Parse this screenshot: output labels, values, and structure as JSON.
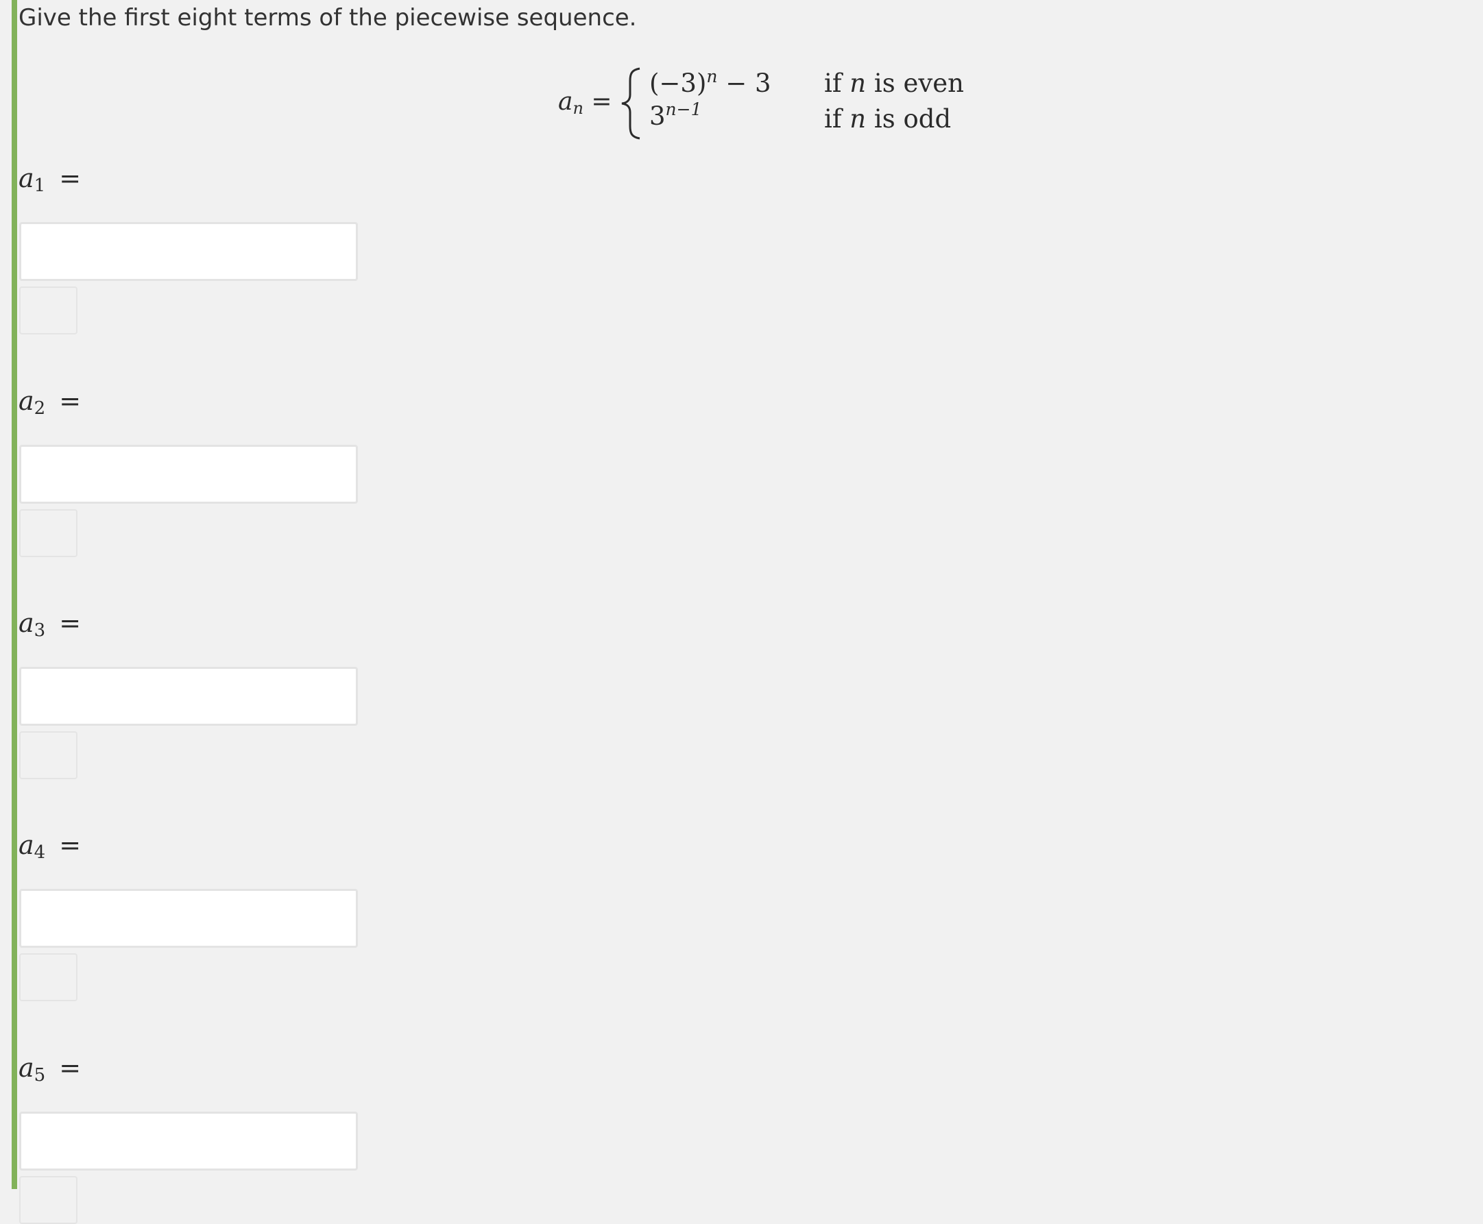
{
  "question": {
    "prompt": "Give the first eight terms of the piecewise sequence."
  },
  "formula": {
    "lhs_var": "a",
    "lhs_sub": "n",
    "equals": "=",
    "case_even_expr": "(−3)",
    "case_even_exp": "n",
    "case_even_tail": " − 3",
    "case_odd_base": "3",
    "case_odd_exp": "n−1",
    "cond_even": {
      "if": "if ",
      "var": "n",
      "rest": " is even"
    },
    "cond_odd": {
      "if": "if ",
      "var": "n",
      "rest": " is odd"
    }
  },
  "terms": [
    {
      "var": "a",
      "sub": "1",
      "equals": "=",
      "value": ""
    },
    {
      "var": "a",
      "sub": "2",
      "equals": "=",
      "value": ""
    },
    {
      "var": "a",
      "sub": "3",
      "equals": "=",
      "value": ""
    },
    {
      "var": "a",
      "sub": "4",
      "equals": "=",
      "value": ""
    },
    {
      "var": "a",
      "sub": "5",
      "equals": "=",
      "value": ""
    }
  ],
  "colors": {
    "accent_bar": "#82b25a",
    "background": "#f1f1f1",
    "input_border": "#e3e3e3"
  }
}
